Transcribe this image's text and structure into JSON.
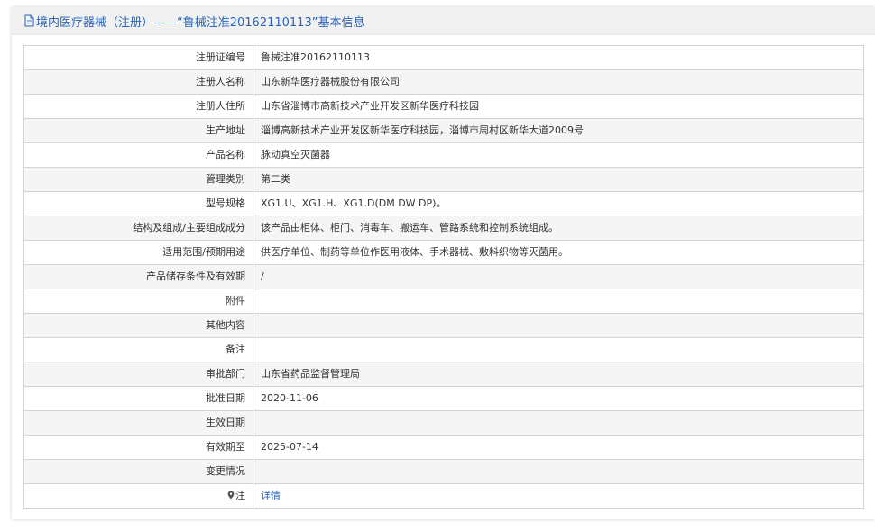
{
  "header": {
    "title": "境内医疗器械（注册）——“鲁械注准20162110113”基本信息",
    "icon": "document-icon"
  },
  "colors": {
    "title": "#2a64b8",
    "link": "#2a64b8",
    "border": "#d4d4d4",
    "row_alt": "#f5f5f5"
  },
  "fields": [
    {
      "label": "注册证编号",
      "value": "鲁械注准20162110113"
    },
    {
      "label": "注册人名称",
      "value": "山东新华医疗器械股份有限公司"
    },
    {
      "label": "注册人住所",
      "value": "山东省淄博市高新技术产业开发区新华医疗科技园"
    },
    {
      "label": "生产地址",
      "value": "淄博高新技术产业开发区新华医疗科技园，淄博市周村区新华大道2009号"
    },
    {
      "label": "产品名称",
      "value": "脉动真空灭菌器"
    },
    {
      "label": "管理类别",
      "value": "第二类"
    },
    {
      "label": "型号规格",
      "value": "XG1.U、XG1.H、XG1.D(DM DW DP)。"
    },
    {
      "label": "结构及组成/主要组成成分",
      "value": "该产品由柜体、柜门、消毒车、搬运车、管路系统和控制系统组成。"
    },
    {
      "label": "适用范围/预期用途",
      "value": "供医疗单位、制药等单位作医用液体、手术器械、敷料织物等灭菌用。"
    },
    {
      "label": "产品储存条件及有效期",
      "value": "/"
    },
    {
      "label": "附件",
      "value": ""
    },
    {
      "label": "其他内容",
      "value": ""
    },
    {
      "label": "备注",
      "value": ""
    },
    {
      "label": "审批部门",
      "value": "山东省药品监督管理局"
    },
    {
      "label": "批准日期",
      "value": "2020-11-06"
    },
    {
      "label": "生效日期",
      "value": ""
    },
    {
      "label": "有效期至",
      "value": "2025-07-14"
    },
    {
      "label": "变更情况",
      "value": ""
    }
  ],
  "note_row": {
    "label": "注",
    "icon": "map-pin-icon",
    "link_text": "详情"
  }
}
